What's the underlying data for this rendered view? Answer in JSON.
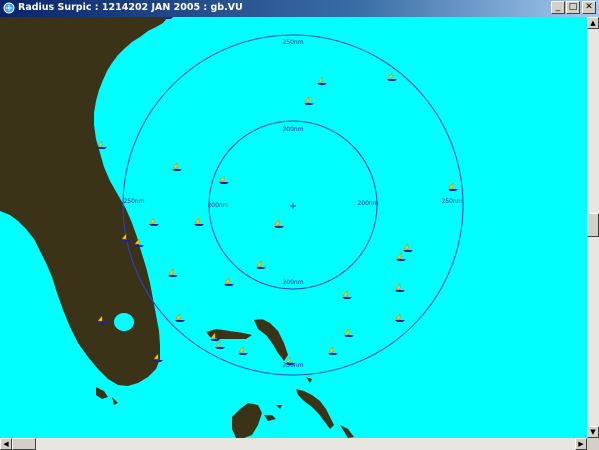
{
  "window": {
    "title": "Radius Surpic : 1214202 JAN 2005 : gb.VU",
    "minimize_glyph": "_",
    "maximize_glyph": "□",
    "close_glyph": "✕"
  },
  "map": {
    "background_color": "#00ffff",
    "land_color": "#3b3318",
    "ring_color": "#2a3fd0",
    "inner_ring": {
      "label": "200nm"
    },
    "outer_ring": {
      "label": "250nm"
    },
    "ring_labels": {
      "inner_top": "200nm",
      "inner_left": "200nm",
      "inner_right": "200nm",
      "inner_bottom": "200nm",
      "outer_top": "250nm",
      "outer_left": "250nm",
      "outer_right": "250nm",
      "outer_bottom": "250nm"
    },
    "center_marker": "+",
    "vessel_count": 30
  },
  "scrollbars": {
    "up": "▲",
    "down": "▼",
    "left": "◀",
    "right": "▶"
  }
}
